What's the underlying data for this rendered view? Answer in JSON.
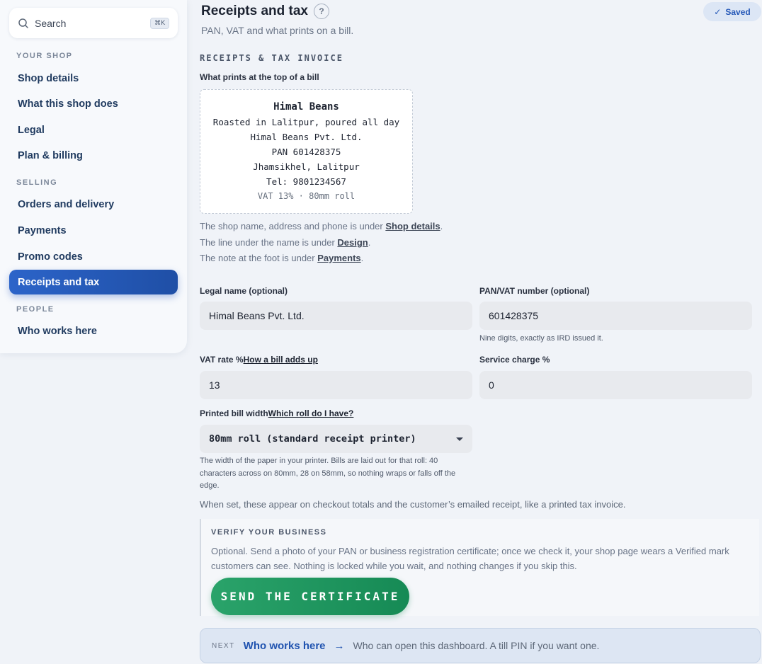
{
  "sidebar": {
    "search_label": "Search",
    "search_shortcut": "⌘K",
    "sections": [
      {
        "title": "YOUR SHOP",
        "items": [
          "Shop details",
          "What this shop does",
          "Legal",
          "Plan & billing"
        ]
      },
      {
        "title": "SELLING",
        "items": [
          "Orders and delivery",
          "Payments",
          "Promo codes",
          "Receipts and tax"
        ]
      },
      {
        "title": "PEOPLE",
        "items": [
          "Who works here"
        ]
      }
    ],
    "active_item": "Receipts and tax"
  },
  "header": {
    "title": "Receipts and tax",
    "help": "?",
    "subtitle": "PAN, VAT and what prints on a bill.",
    "saved_label": "Saved"
  },
  "receipt_section": {
    "heading": "RECEIPTS & TAX INVOICE",
    "preview_label": "What prints at the top of a bill",
    "preview": {
      "name": "Himal Beans",
      "tagline": "Roasted in Lalitpur, poured all day",
      "legal_name": "Himal Beans Pvt. Ltd.",
      "pan": "PAN 601428375",
      "address": "Jhamsikhel, Lalitpur",
      "tel": "Tel: 9801234567",
      "meta": "VAT 13% · 80mm roll"
    },
    "hints": [
      {
        "before": "The shop name, address and phone is under ",
        "link": "Shop details",
        "after": "."
      },
      {
        "before": "The line under the name is under ",
        "link": "Design",
        "after": "."
      },
      {
        "before": "The note at the foot is under ",
        "link": "Payments",
        "after": "."
      }
    ]
  },
  "fields": {
    "legal_name": {
      "label": "Legal name (optional)",
      "value": "Himal Beans Pvt. Ltd."
    },
    "pan_vat": {
      "label": "PAN/VAT number (optional)",
      "value": "601428375",
      "help": "Nine digits, exactly as IRD issued it."
    },
    "vat_rate": {
      "label": "VAT rate %",
      "link": "How a bill adds up",
      "value": "13"
    },
    "service_charge": {
      "label": "Service charge %",
      "value": "0"
    },
    "bill_width": {
      "label": "Printed bill width",
      "link": "Which roll do I have?",
      "value": "80mm roll (standard receipt printer)",
      "help": "The width of the paper in your printer. Bills are laid out for that roll: 40 characters across on 80mm, 28 on 58mm, so nothing wraps or falls off the edge."
    }
  },
  "note": "When set, these appear on checkout totals and the customer’s emailed receipt, like a printed tax invoice.",
  "verify": {
    "heading": "VERIFY YOUR BUSINESS",
    "body": "Optional. Send a photo of your PAN or business registration certificate; once we check it, your shop page wears a Verified mark customers can see. Nothing is locked while you wait, and nothing changes if you skip this.",
    "button": "SEND THE CERTIFICATE"
  },
  "next": {
    "tag": "NEXT",
    "title": "Who works here",
    "arrow": "→",
    "description": "Who can open this dashboard. A till PIN if you want one."
  },
  "colors": {
    "accent": "#2558b8",
    "active_nav": "#2c64c9",
    "button_green": "#1f9a60"
  }
}
